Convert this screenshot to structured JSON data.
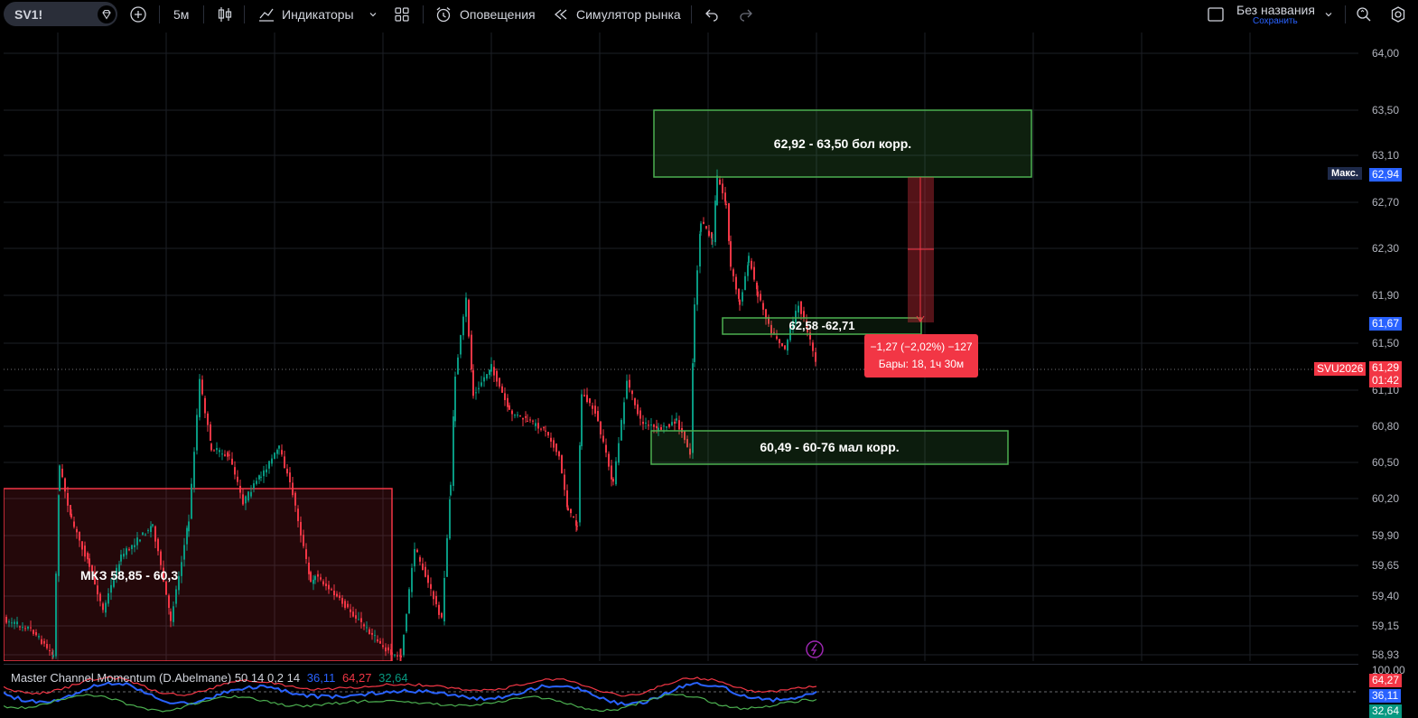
{
  "toolbar": {
    "symbol": "SV1!",
    "interval": "5м",
    "indicators_label": "Индикаторы",
    "alerts_label": "Оповещения",
    "replay_label": "Симулятор рынка",
    "layout_name": "Без названия",
    "save_label": "Сохранить"
  },
  "price_axis": {
    "ticks": [
      "64,00",
      "63,50",
      "63,10",
      "62,70",
      "62,30",
      "61,90",
      "61,50",
      "61,10",
      "60,80",
      "60,50",
      "60,20",
      "59,90",
      "59,65",
      "59,40",
      "59,15",
      "58,93"
    ],
    "max_label": "Макс.",
    "max_value": "62,94",
    "level_value": "61,67",
    "symbol_tag": "SVU2026",
    "last_price": "61,29",
    "countdown": "01:42"
  },
  "zones": {
    "upper": "62,92 - 63,50 бол корр.",
    "middle": "62,58 -62,71",
    "lower": "60,49 - 60-76 мал корр.",
    "left": "МКЗ 58,85 - 60,3"
  },
  "measure": {
    "change": "−1,27 (−2,02%) −127",
    "bars": "Бары: 18, 1ч 30м"
  },
  "indicator": {
    "name": "Master Channel Momentum (D.Abelmane) 50 14 0,2 14",
    "v1": "36,11",
    "v2": "64,27",
    "v3": "32,64",
    "axis_top": "100,00",
    "tag1": "64,27",
    "tag2": "36,11",
    "tag3": "32,64"
  },
  "colors": {
    "up": "#089981",
    "down": "#f23645",
    "zone_green": "#4caf50",
    "zone_red": "#f23645",
    "blue_series": "#2962ff",
    "accent": "#2962ff"
  }
}
